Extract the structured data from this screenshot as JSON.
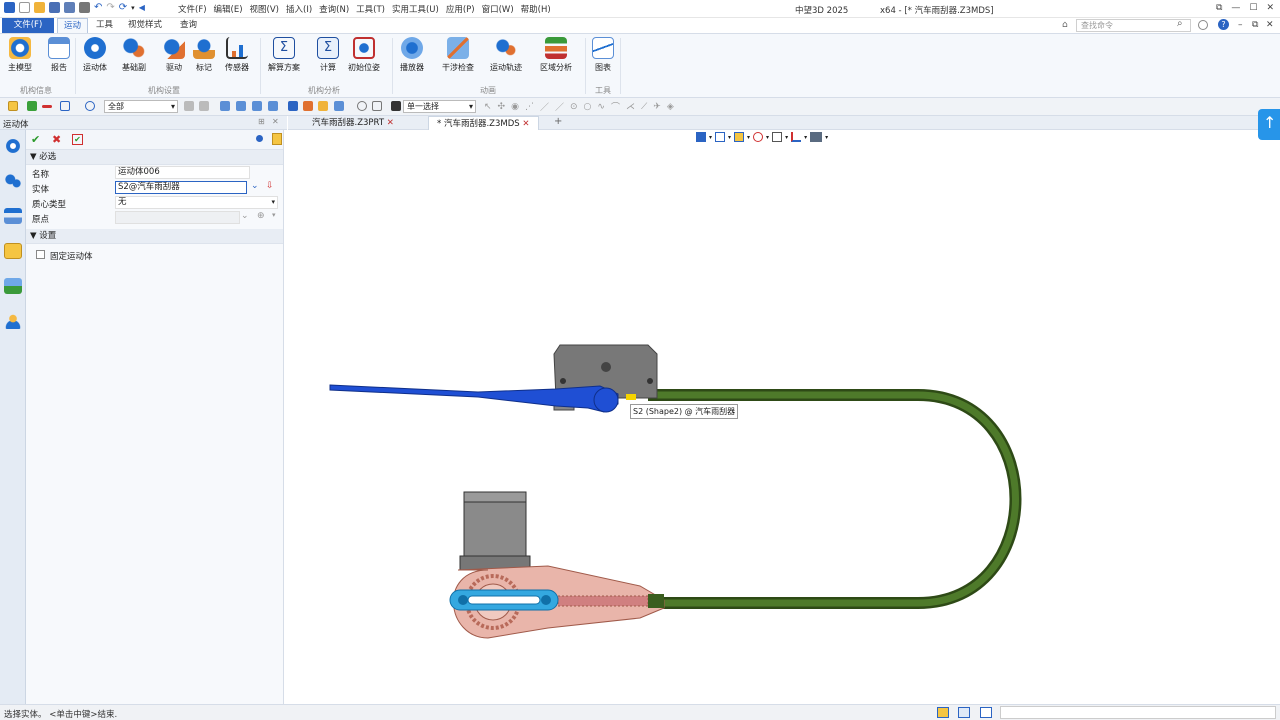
{
  "menu": [
    "文件(F)",
    "编辑(E)",
    "视图(V)",
    "插入(I)",
    "查询(N)",
    "工具(T)",
    "实用工具(U)",
    "应用(P)",
    "窗口(W)",
    "帮助(H)"
  ],
  "app_title": "中望3D 2025",
  "doc_title": "x64 - [* 汽车雨刮器.Z3MDS]",
  "ribbon_tabs": {
    "file": "文件(F)",
    "motion": "运动",
    "tools": "工具",
    "visual": "视觉样式",
    "query": "查询"
  },
  "cmd_search_placeholder": "查找命令",
  "ribbon": {
    "main_model": "主模型",
    "report": "报告",
    "motion_body": "运动体",
    "base_pair": "基础副",
    "drive": "驱动",
    "mark": "标记",
    "sensor": "传感器",
    "solve_plan": "解算方案",
    "compute": "计算",
    "initial_pos": "初始位姿",
    "player": "播放器",
    "interference": "干涉检查",
    "motion_track": "运动轨迹",
    "area_analysis": "区域分析",
    "chart": "图表",
    "groups": {
      "info": "机构信息",
      "setup": "机构设置",
      "analysis": "机构分析",
      "animation": "动画",
      "tools": "工具"
    }
  },
  "toolbar2": {
    "filter": "全部",
    "select_mode": "单一选择"
  },
  "panel": {
    "title": "运动体",
    "section_required": "必选",
    "fields": {
      "name_label": "名称",
      "name_value": "运动体006",
      "entity_label": "实体",
      "entity_value": "S2@汽车雨刮器",
      "mass_label": "质心类型",
      "mass_value": "无",
      "origin_label": "原点",
      "origin_value": ""
    },
    "section_settings": "设置",
    "fixed_label": "固定运动体"
  },
  "doc_tabs": [
    {
      "label": "汽车雨刮器.Z3PRT",
      "active": false
    },
    {
      "label": "* 汽车雨刮器.Z3MDS",
      "active": true
    }
  ],
  "tooltip": "S2 (Shape2) @ 汽车雨刮器",
  "status": "选择实体。 <单击中键>结束.",
  "colors": {
    "accent": "#2b64c3",
    "arm": "#1f4fd4",
    "cable": "#3b5e1f",
    "gearbox": "#e9b5aa",
    "motor": "#777777",
    "link": "#34a8e0"
  }
}
